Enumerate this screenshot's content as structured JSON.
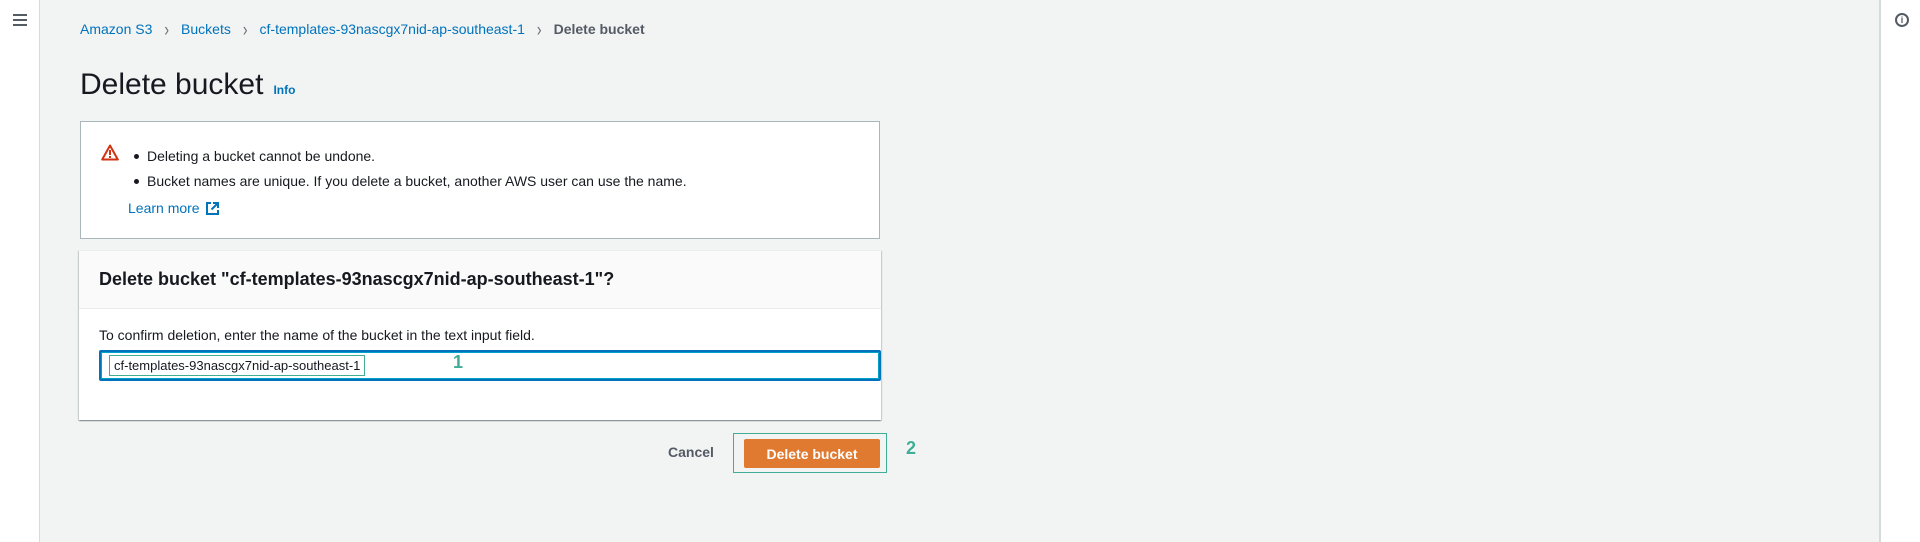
{
  "nav": {
    "menu_icon": "hamburger-menu-icon",
    "help_icon": "info-circle-icon",
    "help_glyph": "i"
  },
  "breadcrumb": [
    {
      "label": "Amazon S3",
      "link": true
    },
    {
      "label": "Buckets",
      "link": true
    },
    {
      "label": "cf-templates-93nascgx7nid-ap-southeast-1",
      "link": true
    },
    {
      "label": "Delete bucket",
      "link": false
    }
  ],
  "breadcrumb_separator": "›",
  "page": {
    "title": "Delete bucket",
    "info_label": "Info"
  },
  "warning": {
    "icon": "warning-triangle-icon",
    "bullets": [
      "Deleting a bucket cannot be undone.",
      "Bucket names are unique. If you delete a bucket, another AWS user can use the name."
    ],
    "learn_more_label": "Learn more",
    "learn_more_icon": "external-link-icon"
  },
  "confirm": {
    "heading": "Delete bucket \"cf-templates-93nascgx7nid-ap-southeast-1\"?",
    "instruction": "To confirm deletion, enter the name of the bucket in the text input field.",
    "input_value": "cf-templates-93nascgx7nid-ap-southeast-1"
  },
  "actions": {
    "cancel_label": "Cancel",
    "delete_label": "Delete bucket"
  },
  "annotations": {
    "step_1": "1",
    "step_2": "2",
    "color": "#3fae95"
  },
  "colors": {
    "link": "#0073bb",
    "primary_button": "#e07a30",
    "warning": "#d13212"
  }
}
